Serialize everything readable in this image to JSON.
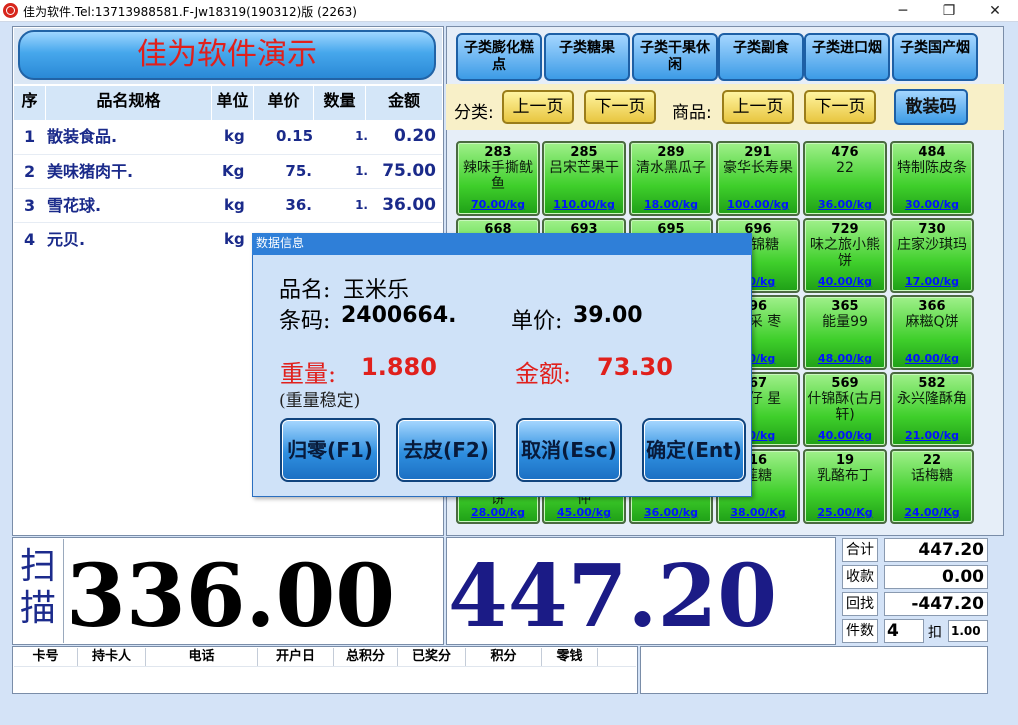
{
  "window": {
    "title": "佳为软件.Tel:13713988581.F-Jw18319(190312)版 (2263)",
    "minimize": "─",
    "maximize": "❐",
    "close": "✕"
  },
  "brand": "佳为软件演示",
  "grid": {
    "headers": [
      "序",
      "品名规格",
      "单位",
      "单价",
      "数量",
      "金额"
    ],
    "rows": [
      {
        "no": "1",
        "name": "散装食品.",
        "unit": "kg",
        "price": "0.15",
        "qty": "1.",
        "amount": "0.20"
      },
      {
        "no": "2",
        "name": "美味猪肉干.",
        "unit": "Kg",
        "price": "75.",
        "qty": "1.",
        "amount": "75.00"
      },
      {
        "no": "3",
        "name": "雪花球.",
        "unit": "kg",
        "price": "36.",
        "qty": "1.",
        "amount": "36.00"
      },
      {
        "no": "4",
        "name": "元贝.",
        "unit": "kg",
        "price": "",
        "qty": "",
        "amount": ""
      }
    ]
  },
  "subcategories": [
    "子类膨化糕点",
    "子类糖果",
    "子类干果休闲",
    "子类副食",
    "子类进口烟",
    "子类国产烟"
  ],
  "nav": {
    "category_label": "分类:",
    "product_label": "商品:",
    "prev": "上一页",
    "next": "下一页",
    "bulk": "散装码"
  },
  "products": [
    {
      "code": "283",
      "name": "辣味手撕鱿鱼",
      "price": "70.00/kg"
    },
    {
      "code": "285",
      "name": "吕宋芒果干",
      "price": "110.00/kg"
    },
    {
      "code": "289",
      "name": "清水黑瓜子",
      "price": "18.00/kg"
    },
    {
      "code": "291",
      "name": "豪华长寿果",
      "price": "100.00/kg"
    },
    {
      "code": "476",
      "name": "22",
      "price": "36.00/kg"
    },
    {
      "code": "484",
      "name": "特制陈皮条",
      "price": "30.00/kg"
    },
    {
      "code": "668",
      "name": "",
      "price": ""
    },
    {
      "code": "693",
      "name": "",
      "price": ""
    },
    {
      "code": "695",
      "name": "",
      "price": ""
    },
    {
      "code": "696",
      "name": "什锦糖",
      "price": "00/kg"
    },
    {
      "code": "729",
      "name": "味之旅小熊饼",
      "price": "40.00/kg"
    },
    {
      "code": "730",
      "name": "庄家沙琪玛",
      "price": "17.00/kg"
    },
    {
      "code": "",
      "name": "",
      "price": ""
    },
    {
      "code": "",
      "name": "",
      "price": ""
    },
    {
      "code": "",
      "name": "",
      "price": ""
    },
    {
      "code": "96",
      "name": "隆采 枣",
      "price": "00/kg"
    },
    {
      "code": "365",
      "name": "能量99",
      "price": "48.00/kg"
    },
    {
      "code": "366",
      "name": "麻糍Q饼",
      "price": "40.00/kg"
    },
    {
      "code": "",
      "name": "",
      "price": ""
    },
    {
      "code": "",
      "name": "",
      "price": ""
    },
    {
      "code": "",
      "name": "",
      "price": ""
    },
    {
      "code": "67",
      "name": "玛仔 星",
      "price": "00/kg"
    },
    {
      "code": "569",
      "name": "什锦酥(古月轩)",
      "price": "40.00/kg"
    },
    {
      "code": "582",
      "name": "永兴隆酥角",
      "price": "21.00/kg"
    },
    {
      "code": "",
      "name": "",
      "price": ""
    },
    {
      "code": "",
      "name": "",
      "price": ""
    },
    {
      "code": "",
      "name": "",
      "price": ""
    },
    {
      "code": "16",
      "name": "莲糖",
      "price": "38.00/Kg"
    },
    {
      "code": "19",
      "name": "乳酪布丁",
      "price": "25.00/Kg"
    },
    {
      "code": "22",
      "name": "话梅糖",
      "price": "24.00/Kg"
    }
  ],
  "partial_tiles": [
    {
      "name": "饼",
      "price": "28.00/kg"
    },
    {
      "name": "仲",
      "price": "45.00/kg"
    },
    {
      "name": "",
      "price": "36.00/kg"
    }
  ],
  "scan": {
    "label": "扫描",
    "value": "336.00"
  },
  "total_display": "447.20",
  "summary": [
    {
      "label": "合计",
      "value": "447.20"
    },
    {
      "label": "收款",
      "value": "0.00"
    },
    {
      "label": "回找",
      "value": "-447.20"
    }
  ],
  "count": {
    "label": "件数",
    "value": "4",
    "discount_label": "扣",
    "discount_value": "1.00"
  },
  "member_headers": [
    "卡号",
    "持卡人",
    "电话",
    "开户日",
    "总积分",
    "已奖分",
    "积分",
    "零钱"
  ],
  "dialog": {
    "title": "数据信息",
    "name_label": "品名:",
    "name_value": "玉米乐",
    "barcode_label": "条码:",
    "barcode_value": "2400664.",
    "price_label": "单价:",
    "price_value": "39.00",
    "weight_label": "重量:",
    "weight_value": "1.880",
    "amount_label": "金额:",
    "amount_value": "73.30",
    "stable_text": "(重量稳定)",
    "buttons": [
      "归零(F1)",
      "去皮(F2)",
      "取消(Esc)",
      "确定(Ent)"
    ]
  }
}
